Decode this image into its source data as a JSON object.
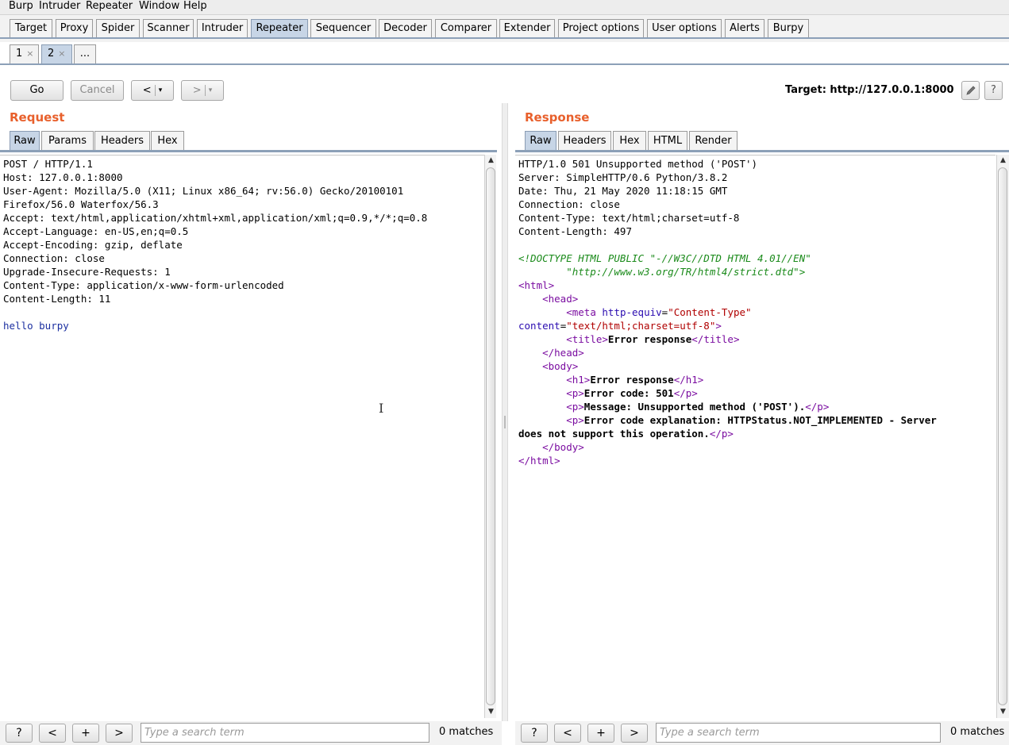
{
  "menubar": [
    "Burp",
    "Intruder",
    "Repeater",
    "Window",
    "Help"
  ],
  "main_tabs": [
    "Target",
    "Proxy",
    "Spider",
    "Scanner",
    "Intruder",
    "Repeater",
    "Sequencer",
    "Decoder",
    "Comparer",
    "Extender",
    "Project options",
    "User options",
    "Alerts",
    "Burpy"
  ],
  "active_main_tab": "Repeater",
  "sub_tabs": [
    {
      "label": "1",
      "close": "×"
    },
    {
      "label": "2",
      "close": "×"
    },
    {
      "label": "..."
    }
  ],
  "active_sub_tab": "2",
  "toolbar": {
    "go": "Go",
    "cancel": "Cancel",
    "back": "<",
    "forward": ">",
    "dropdown": "▾",
    "target": "Target: http://127.0.0.1:8000",
    "edit_icon": "pencil-icon",
    "help": "?"
  },
  "request": {
    "title": "Request",
    "tabs": [
      "Raw",
      "Params",
      "Headers",
      "Hex"
    ],
    "active_tab": "Raw",
    "lines": [
      "POST / HTTP/1.1",
      "Host: 127.0.0.1:8000",
      "User-Agent: Mozilla/5.0 (X11; Linux x86_64; rv:56.0) Gecko/20100101",
      "Firefox/56.0 Waterfox/56.3",
      "Accept: text/html,application/xhtml+xml,application/xml;q=0.9,*/*;q=0.8",
      "Accept-Language: en-US,en;q=0.5",
      "Accept-Encoding: gzip, deflate",
      "Connection: close",
      "Upgrade-Insecure-Requests: 1",
      "Content-Type: application/x-www-form-urlencoded",
      "Content-Length: 11"
    ],
    "body": "hello burpy"
  },
  "response": {
    "title": "Response",
    "tabs": [
      "Raw",
      "Headers",
      "Hex",
      "HTML",
      "Render"
    ],
    "active_tab": "Raw",
    "headers": [
      "HTTP/1.0 501 Unsupported method ('POST')",
      "Server: SimpleHTTP/0.6 Python/3.8.2",
      "Date: Thu, 21 May 2020 11:18:15 GMT",
      "Connection: close",
      "Content-Type: text/html;charset=utf-8",
      "Content-Length: 497"
    ],
    "doctype_1": "<!DOCTYPE HTML PUBLIC \"-//W3C//DTD HTML 4.01//EN\"",
    "doctype_2": "        \"http://www.w3.org/TR/html4/strict.dtd\">",
    "html_open": "<html>",
    "head_open": "<head>",
    "meta_tag": "<meta",
    "meta_attr1": "http-equiv",
    "meta_val1": "\"Content-Type\"",
    "meta_attr2": "content",
    "meta_val2": "\"text/html;charset=utf-8\"",
    "title_open": "<title>",
    "title_text": "Error response",
    "title_close": "</title>",
    "head_close": "</head>",
    "body_open": "<body>",
    "h1_open": "<h1>",
    "h1_text": "Error response",
    "h1_close": "</h1>",
    "p_open": "<p>",
    "p_close": "</p>",
    "p1_text": "Error code: 501",
    "p2_text": "Message: Unsupported method ('POST').",
    "p3_text_a": "Error code explanation: HTTPStatus.NOT_IMPLEMENTED - Server",
    "p3_text_b": "does not support this operation.",
    "body_close": "</body>",
    "html_close": "</html>"
  },
  "search": {
    "help": "?",
    "prev": "<",
    "add": "+",
    "next": ">",
    "placeholder": "Type a search term",
    "matches": "0 matches"
  },
  "scroll_up": "▲",
  "scroll_down": "▼",
  "text_cursor": "I"
}
